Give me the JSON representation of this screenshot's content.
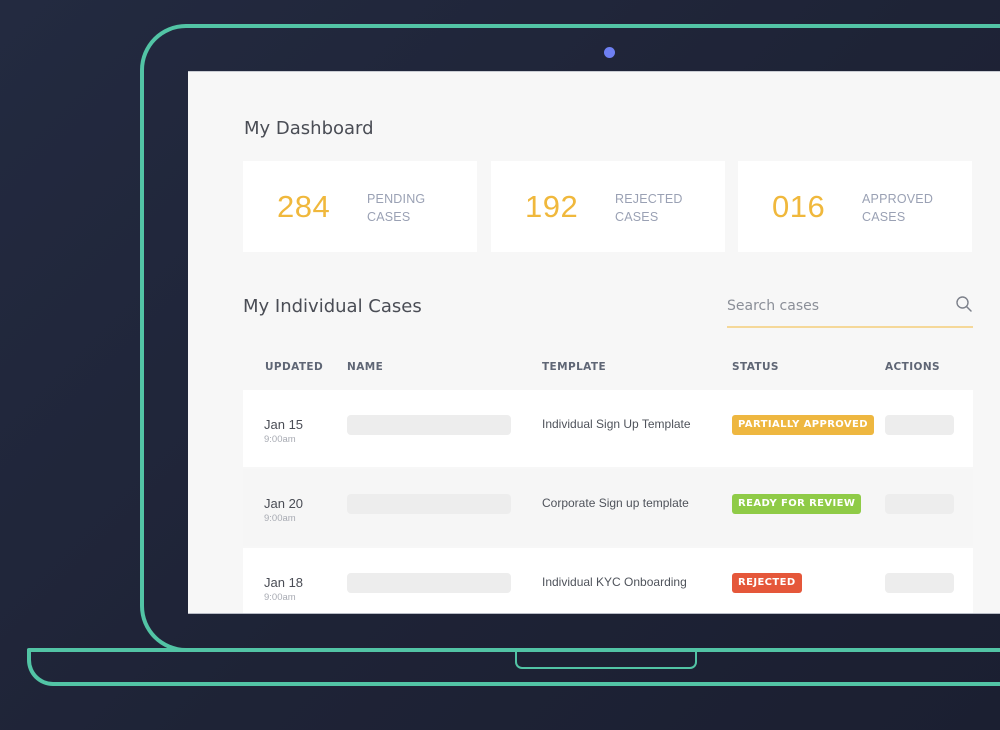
{
  "colors": {
    "accent_orange": "#f0b83c",
    "laptop_outline": "#52c4a5",
    "camera": "#6e7ff2",
    "background": "#1f2438"
  },
  "dashboard": {
    "title": "My Dashboard",
    "stats": [
      {
        "value": "284",
        "label_line1": "PENDING",
        "label_line2": "CASES"
      },
      {
        "value": "192",
        "label_line1": "REJECTED",
        "label_line2": "CASES"
      },
      {
        "value": "016",
        "label_line1": "APPROVED",
        "label_line2": "CASES"
      }
    ]
  },
  "cases": {
    "title": "My Individual Cases",
    "search": {
      "placeholder": "Search cases",
      "value": "",
      "icon": "search-icon"
    },
    "columns": [
      "UPDATED",
      "NAME",
      "TEMPLATE",
      "STATUS",
      "ACTIONS"
    ],
    "rows": [
      {
        "date": "Jan 15",
        "time": "9:00am",
        "template": "Individual Sign Up Template",
        "status": "PARTIALLY APPROVED",
        "status_color": "#eeb740"
      },
      {
        "date": "Jan 20",
        "time": "9:00am",
        "template": "Corporate Sign up template",
        "status": "READY FOR REVIEW",
        "status_color": "#8fcb47"
      },
      {
        "date": "Jan 18",
        "time": "9:00am",
        "template": "Individual KYC Onboarding",
        "status": "REJECTED",
        "status_color": "#e5573a"
      }
    ]
  }
}
